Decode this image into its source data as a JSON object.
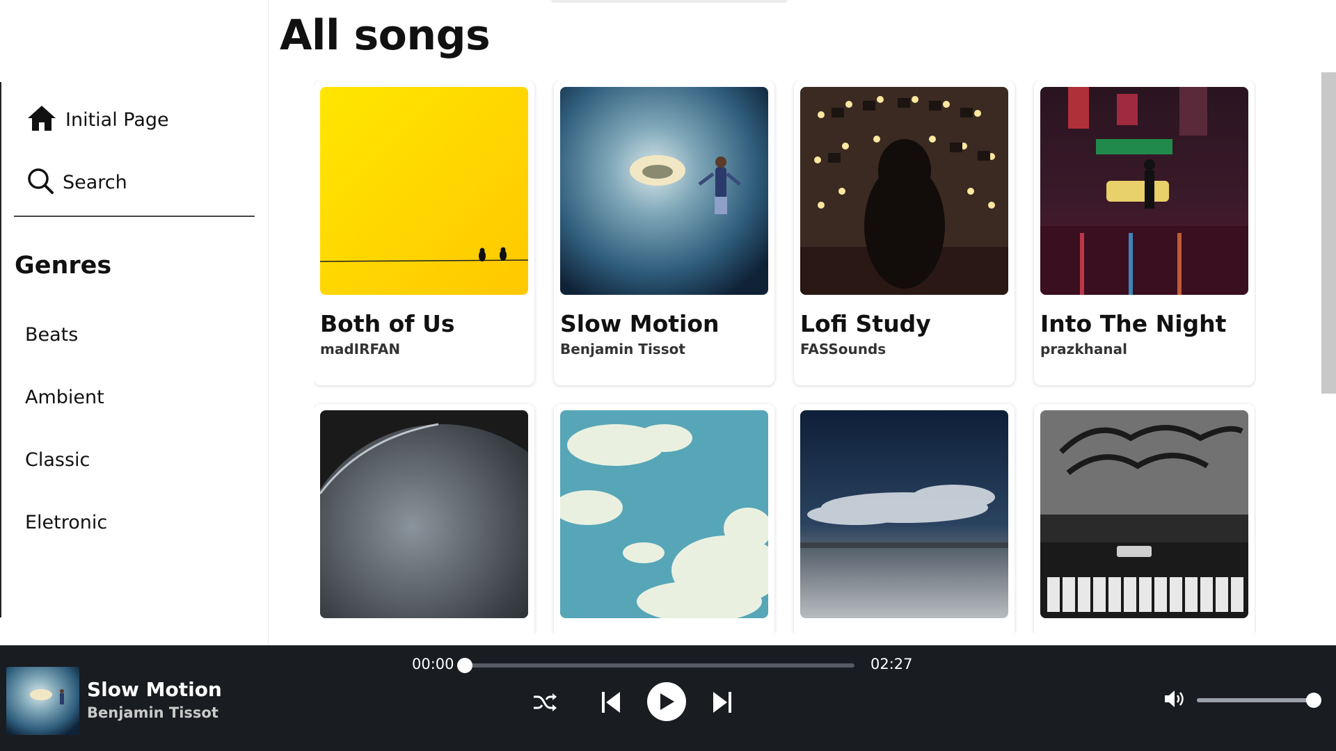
{
  "sidebar": {
    "nav": [
      {
        "label": "Initial Page",
        "icon": "home-icon"
      },
      {
        "label": "Search",
        "icon": "search-icon"
      }
    ],
    "genres_title": "Genres",
    "genres": [
      "Beats",
      "Ambient",
      "Classic",
      "Eletronic"
    ]
  },
  "main": {
    "title": "All songs",
    "songs": [
      {
        "title": "Both of Us",
        "artist": "madIRFAN",
        "art": "yellow-birds-on-wire"
      },
      {
        "title": "Slow Motion",
        "artist": "Benjamin Tissot",
        "art": "boy-in-ice-cave"
      },
      {
        "title": "Lofi Study",
        "artist": "FASSounds",
        "art": "girl-with-fairy-lights"
      },
      {
        "title": "Into The Night",
        "artist": "prazkhanal",
        "art": "neon-city-street"
      },
      {
        "title": "",
        "artist": "",
        "art": "earth-from-space"
      },
      {
        "title": "",
        "artist": "",
        "art": "sky-with-clouds"
      },
      {
        "title": "",
        "artist": "",
        "art": "stormy-plain"
      },
      {
        "title": "",
        "artist": "",
        "art": "piano-black-and-white"
      }
    ]
  },
  "player": {
    "now_playing": {
      "title": "Slow Motion",
      "artist": "Benjamin Tissot",
      "art": "boy-in-ice-cave"
    },
    "current_time": "00:00",
    "total_time": "02:27",
    "progress": 0,
    "volume": 1.0,
    "controls": [
      "shuffle-icon",
      "previous-icon",
      "play-icon",
      "next-icon",
      "volume-icon"
    ]
  },
  "colors": {
    "player_background": "#191c21",
    "accent_yellow": "#ffd600"
  }
}
